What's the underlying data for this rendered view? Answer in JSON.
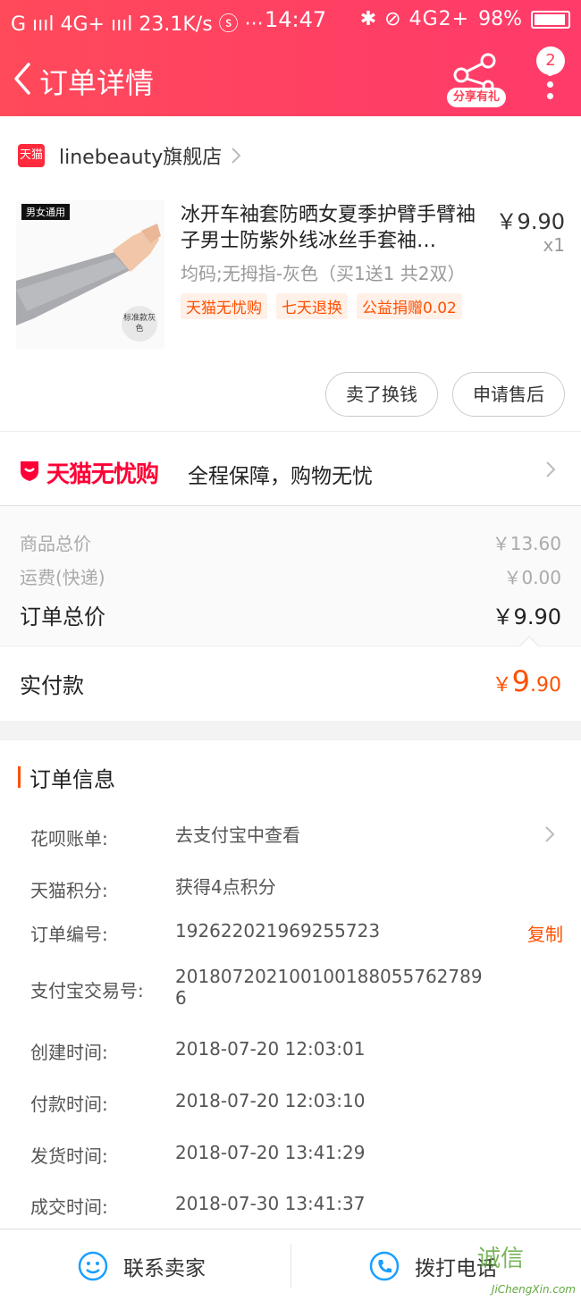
{
  "status_bar": {
    "left": "G ıııl 4G+ ıııl 23.1K/s ⓢ ···",
    "time": "14:47",
    "right_icons": "✱ ⊘ 4G2+",
    "battery": "98%"
  },
  "nav": {
    "title": "订单详情",
    "share_label": "分享有礼",
    "badge_count": "2"
  },
  "shop": {
    "logo_text": "天猫",
    "name": "linebeauty旗舰店"
  },
  "product": {
    "image_tag": "男女通用",
    "image_badge": "标准款灰色",
    "title": "冰开车袖套防晒女夏季护臂手臂袖子男士防紫外线冰丝手套袖…",
    "price": "￥9.90",
    "qty": "x1",
    "sku": "均码;无拇指-灰色（买1送1 共2双）",
    "tags": [
      "天猫无忧购",
      "七天退换",
      "公益捐赠0.02"
    ],
    "buttons": [
      "卖了换钱",
      "申请售后"
    ]
  },
  "guarantee": {
    "logo": "天猫无忧购",
    "text": "全程保障，购物无忧"
  },
  "summary": {
    "goods_label": "商品总价",
    "goods_value": "￥13.60",
    "shipping_label": "运费(快递)",
    "shipping_value": "￥0.00",
    "total_label": "订单总价",
    "total_value": "￥9.90",
    "paid_label": "实付款",
    "paid_currency": "￥",
    "paid_int": "9",
    "paid_dec": ".90"
  },
  "order_info": {
    "title": "订单信息",
    "rows": [
      {
        "key": "花呗账单:",
        "value": "去支付宝中查看"
      },
      {
        "key": "天猫积分:",
        "value": "获得4点积分"
      },
      {
        "key": "订单编号:",
        "value": "192622021969255723",
        "action": "复制"
      },
      {
        "key": "支付宝交易号:",
        "value": "2018072021001001880557627896"
      },
      {
        "key": "创建时间:",
        "value": "2018-07-20 12:03:01"
      },
      {
        "key": "付款时间:",
        "value": "2018-07-20 12:03:10"
      },
      {
        "key": "发货时间:",
        "value": "2018-07-20 13:41:29"
      },
      {
        "key": "成交时间:",
        "value": "2018-07-30 13:41:37"
      }
    ]
  },
  "bottom_bar": {
    "contact_seller": "联系卖家",
    "call_phone": "拨打电话",
    "watermark_chars": "诚信",
    "watermark_url": "JiChengXin.com"
  },
  "colors": {
    "header_red": "#ff4a5a",
    "accent_orange": "#ff5000",
    "tmall_red": "#ff0036"
  }
}
